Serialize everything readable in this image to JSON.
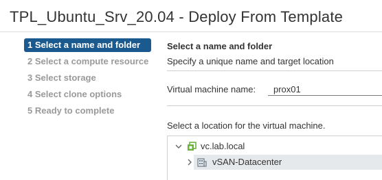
{
  "window": {
    "title": "TPL_Ubuntu_Srv_20.04 - Deploy From Template"
  },
  "steps": [
    {
      "label": "1 Select a name and folder",
      "active": true
    },
    {
      "label": "2 Select a compute resource",
      "active": false
    },
    {
      "label": "3 Select storage",
      "active": false
    },
    {
      "label": "4 Select clone options",
      "active": false
    },
    {
      "label": "5 Ready to complete",
      "active": false
    }
  ],
  "section": {
    "title": "Select a name and folder",
    "description": "Specify a unique name and target location"
  },
  "vm_name": {
    "label": "Virtual machine name:",
    "value": "prox01"
  },
  "location": {
    "label": "Select a location for the virtual machine.",
    "tree": [
      {
        "label": "vc.lab.local",
        "icon": "vcenter-icon",
        "expanded": true
      },
      {
        "label": "vSAN-Datacenter",
        "icon": "datacenter-icon",
        "expanded": false,
        "selected": true
      }
    ]
  },
  "colors": {
    "accent": "#1b5a8e",
    "vcenter": "#6bb33e",
    "selected_row": "#e6e9ec"
  }
}
